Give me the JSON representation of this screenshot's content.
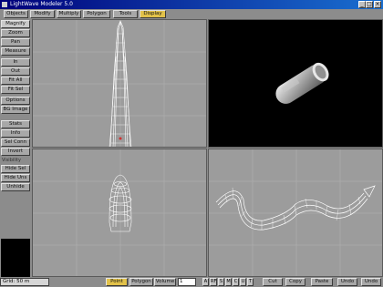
{
  "window": {
    "title": "LightWave Modeler 5.0",
    "controls": [
      "_",
      "□",
      "×"
    ]
  },
  "tabs": [
    {
      "label": "Objects",
      "active": false
    },
    {
      "label": "Modify",
      "active": false
    },
    {
      "label": "Multiply",
      "active": false
    },
    {
      "label": "Polygon",
      "active": false
    },
    {
      "label": "Tools",
      "active": false
    },
    {
      "label": "Display",
      "active": true
    }
  ],
  "sidebar": {
    "buttons": [
      "Magnify",
      "Zoom",
      "Pan",
      "Measure",
      "In",
      "Out",
      "Fit All",
      "Fit Sel",
      "Options",
      "BG Image",
      "Stats",
      "Info",
      "Sel Conn",
      "Invert",
      "Hide Sel",
      "Hide Uns",
      "Unhide"
    ],
    "selected": "Magnify",
    "section_label": "Visibility"
  },
  "status": {
    "grid": "Grid: 50 m",
    "mode_buttons": [
      "Point",
      "Polygon",
      "Volume"
    ],
    "active_mode": "Point",
    "value": "1",
    "tool_icons": [
      "A",
      "RF",
      "S",
      "M",
      "C",
      "U",
      "T",
      "H"
    ],
    "right_buttons": [
      "Cut",
      "Copy",
      "Paste",
      "Undo",
      "Undo"
    ]
  },
  "colors": {
    "accent": "#e2c24a",
    "titlebar": "#00007a",
    "viewport": "#9c9c9c",
    "mesh": "#ffffff"
  }
}
